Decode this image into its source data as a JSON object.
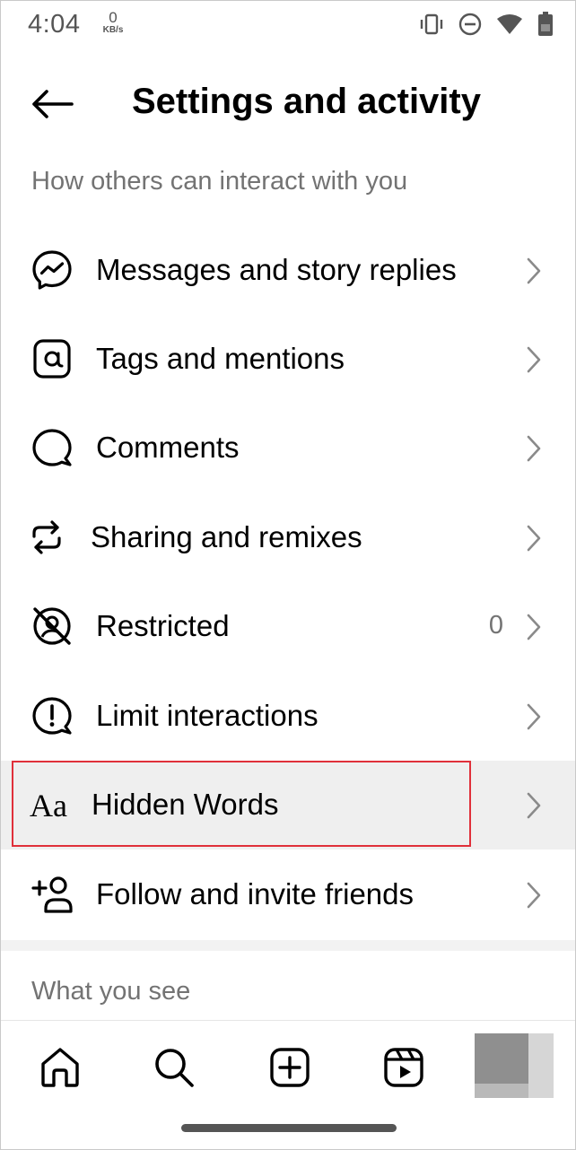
{
  "status_bar": {
    "time": "4:04",
    "net_speed_value": "0",
    "net_speed_unit": "KB/s",
    "icons": [
      "vibrate-icon",
      "do-not-disturb-icon",
      "wifi-icon",
      "battery-icon"
    ]
  },
  "header": {
    "title": "Settings and activity",
    "back_icon": "back-arrow-icon"
  },
  "sections": {
    "interact_title": "How others can interact with you",
    "see_title": "What you see"
  },
  "rows": [
    {
      "label": "Messages and story replies",
      "icon": "messenger-icon",
      "count": ""
    },
    {
      "label": "Tags and mentions",
      "icon": "at-sign-icon",
      "count": ""
    },
    {
      "label": "Comments",
      "icon": "comment-bubble-icon",
      "count": ""
    },
    {
      "label": "Sharing and remixes",
      "icon": "share-remix-icon",
      "count": ""
    },
    {
      "label": "Restricted",
      "icon": "restricted-icon",
      "count": "0"
    },
    {
      "label": "Limit interactions",
      "icon": "limit-interactions-icon",
      "count": ""
    },
    {
      "label": "Hidden Words",
      "icon": "text-aa-icon",
      "count": "",
      "highlighted": true
    },
    {
      "label": "Follow and invite friends",
      "icon": "add-person-icon",
      "count": ""
    }
  ],
  "bottom_nav": {
    "items": [
      "home-icon",
      "search-icon",
      "create-icon",
      "reels-icon",
      "profile-avatar"
    ]
  },
  "colors": {
    "highlight_border": "#e0303a",
    "highlight_bg": "#efefef",
    "secondary_text": "#737373"
  }
}
